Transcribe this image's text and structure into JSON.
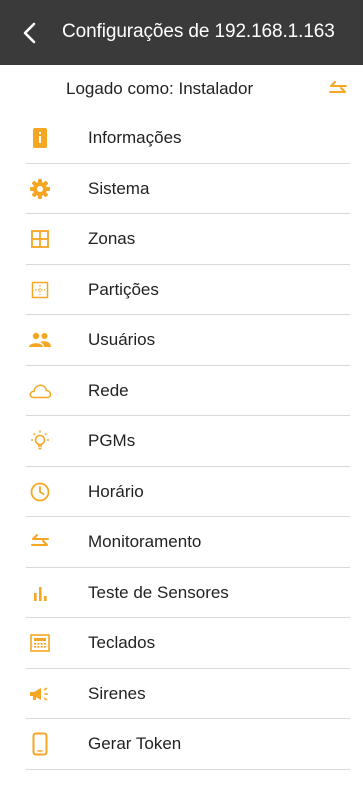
{
  "header": {
    "title": "Configurações de 192.168.1.163"
  },
  "session": {
    "logged_as": "Logado como: Instalador"
  },
  "colors": {
    "accent": "#f5a623",
    "header_bg": "#3a3a3a"
  },
  "menu": {
    "items": [
      {
        "label": "Informações",
        "icon": "info-phone-icon"
      },
      {
        "label": "Sistema",
        "icon": "gear-icon"
      },
      {
        "label": "Zonas",
        "icon": "grid-icon"
      },
      {
        "label": "Partições",
        "icon": "partition-icon"
      },
      {
        "label": "Usuários",
        "icon": "users-icon"
      },
      {
        "label": "Rede",
        "icon": "cloud-icon"
      },
      {
        "label": "PGMs",
        "icon": "lightbulb-icon"
      },
      {
        "label": "Horário",
        "icon": "clock-icon"
      },
      {
        "label": "Monitoramento",
        "icon": "swap-arrows-icon"
      },
      {
        "label": "Teste de Sensores",
        "icon": "bar-chart-icon"
      },
      {
        "label": "Teclados",
        "icon": "keypad-icon"
      },
      {
        "label": "Sirenes",
        "icon": "megaphone-icon"
      },
      {
        "label": "Gerar Token",
        "icon": "phone-icon"
      }
    ]
  }
}
